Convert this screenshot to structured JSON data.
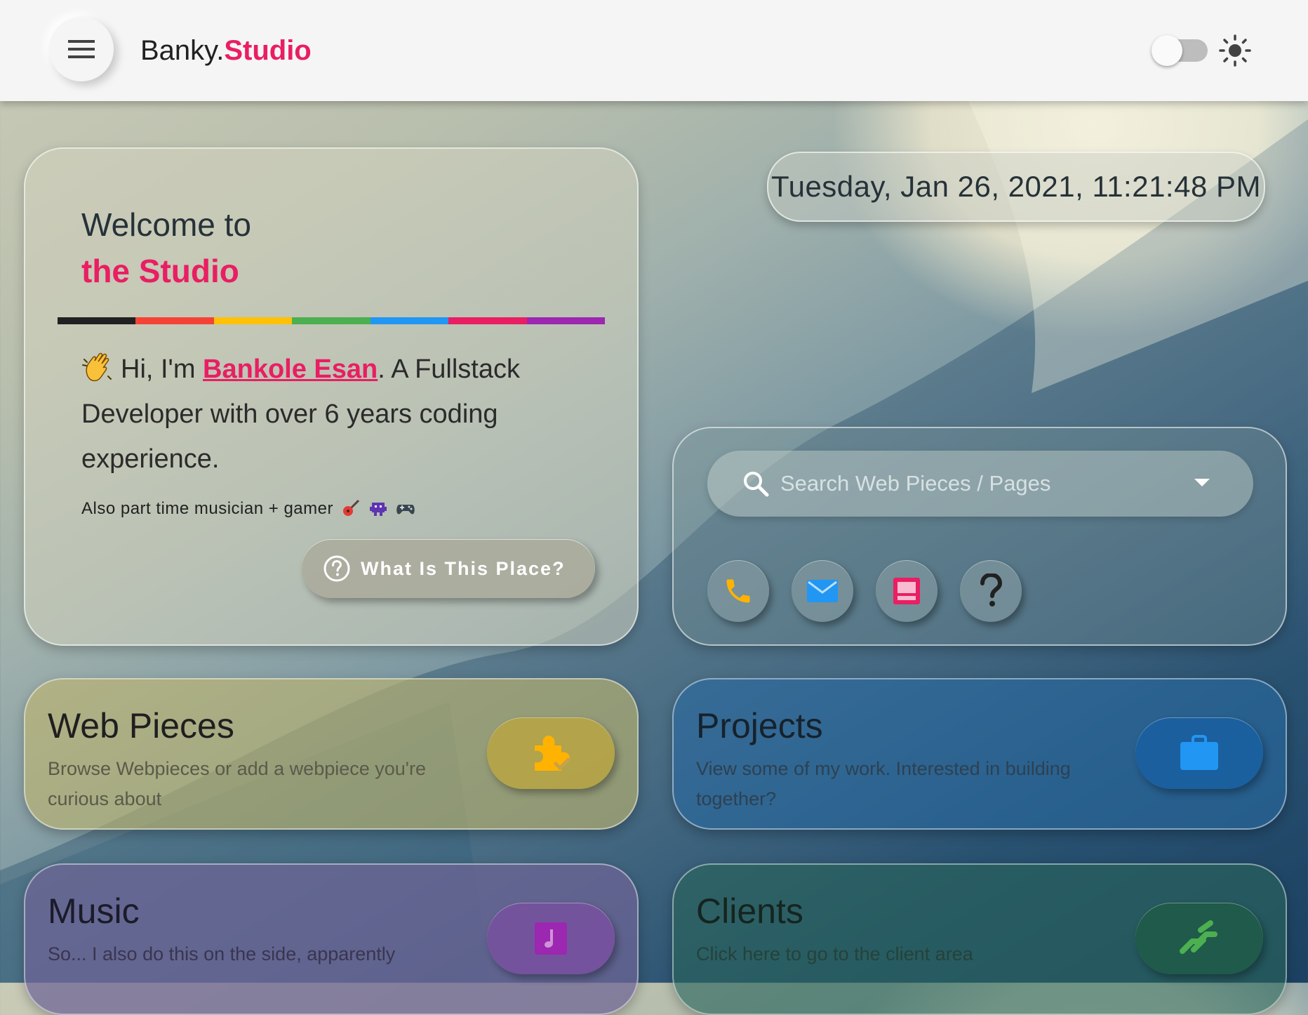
{
  "header": {
    "brand_prefix": "Banky.",
    "brand_suffix": "Studio",
    "theme_toggle_on": false
  },
  "welcome": {
    "line1": "Welcome to",
    "line2": "the Studio",
    "bio_greeting": "Hi, I'm ",
    "bio_name": "Bankole Esan",
    "bio_rest": ". A Fullstack Developer with over 6 years coding experience.",
    "hobby": "Also part time musician + gamer",
    "cta_label": "What Is This Place?",
    "rainbow_colors": [
      "#212121",
      "#f44336",
      "#ffc107",
      "#4caf50",
      "#2196f3",
      "#e91e63",
      "#9c27b0"
    ]
  },
  "datetime": "Tuesday, Jan 26, 2021, 11:21:48 PM",
  "search": {
    "placeholder": "Search Web Pieces / Pages",
    "quick_actions": [
      "phone-icon",
      "mail-icon",
      "resume-icon",
      "help-icon"
    ]
  },
  "tiles": {
    "web_pieces": {
      "title": "Web Pieces",
      "desc": "Browse Webpieces or add a webpiece you're curious about",
      "icon": "puzzle-check-icon"
    },
    "projects": {
      "title": "Projects",
      "desc": "View some of my work. Interested in building together?",
      "icon": "briefcase-icon"
    },
    "music": {
      "title": "Music",
      "desc": "So... I also do this on the side, apparently",
      "icon": "music-note-icon"
    },
    "clients": {
      "title": "Clients",
      "desc": "Click here to go to the client area",
      "icon": "handshake-icon"
    }
  },
  "colors": {
    "accent": "#e91e63",
    "header_bg": "#f5f5f5"
  }
}
